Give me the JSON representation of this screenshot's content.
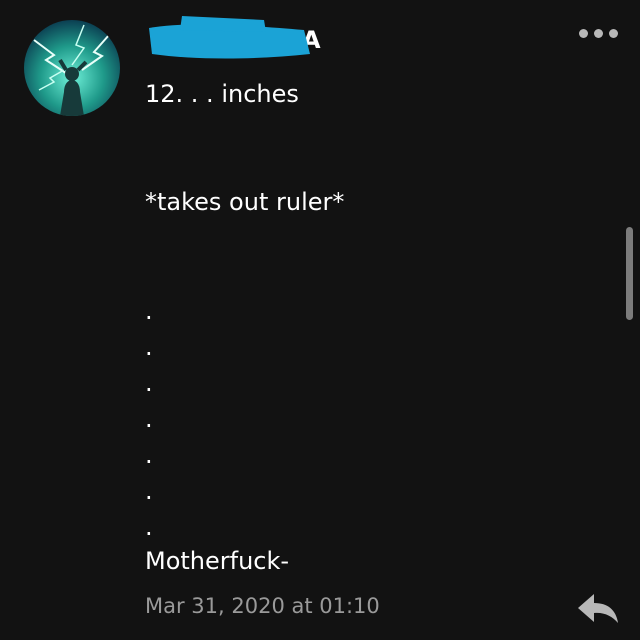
{
  "post": {
    "author": {
      "name_visible": "A",
      "avatar_icon": "lightning-avatar-icon"
    },
    "lines": [
      "12. . . inches",
      "*takes out ruler*",
      ".",
      ".",
      ".",
      ".",
      ".",
      ".",
      ".",
      "Motherfuck-"
    ],
    "timestamp": "Mar 31, 2020 at 01:10"
  },
  "icons": {
    "more": "more-options-icon",
    "reply": "reply-icon"
  },
  "colors": {
    "background": "#121212",
    "text": "#ffffff",
    "timestamp": "#9a9a9a",
    "redaction": "#1ba3d6"
  }
}
